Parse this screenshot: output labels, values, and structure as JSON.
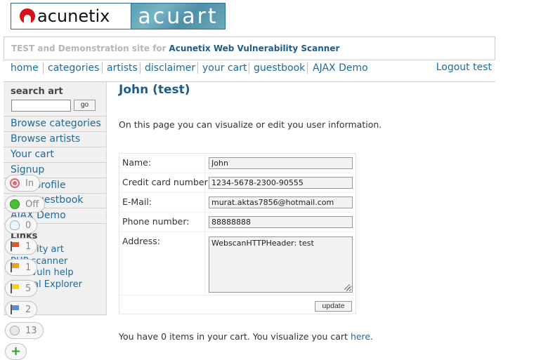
{
  "logo": {
    "left_text": "acunetix",
    "right_text": "acuart"
  },
  "tagline": {
    "prefix": "TEST and Demonstration site for",
    "product": "Acunetix Web Vulnerability Scanner"
  },
  "nav": {
    "items": [
      "home",
      "categories",
      "artists",
      "disclaimer",
      "your cart",
      "guestbook",
      "AJAX Demo"
    ],
    "logout": "Logout test"
  },
  "sidebar": {
    "search_title": "search art",
    "search_placeholder": "",
    "go": "go",
    "links": [
      "Browse categories",
      "Browse artists",
      "Your cart",
      "Signup",
      "Your profile",
      "Our guestbook",
      "AJAX Demo"
    ],
    "section_links": "Links",
    "extra_links": [
      "Security art",
      "PHP scanner",
      "PHP vuln help",
      "Fractal Explorer"
    ]
  },
  "main": {
    "title": "John (test)",
    "intro": "On this page you can visualize or edit you user information.",
    "form": {
      "name_label": "Name:",
      "name_value": "John",
      "cc_label": "Credit card number:",
      "cc_value": "1234-5678-2300-90555",
      "email_label": "E-Mail:",
      "email_value": "murat.aktas7856@hotmail.com",
      "phone_label": "Phone number:",
      "phone_value": "88888888",
      "address_label": "Address:",
      "address_value": "WebscanHTTPHeader: test",
      "update": "update"
    },
    "cart_note_prefix": "You have 0 items in your cart. You visualize you cart",
    "cart_note_link": "here",
    "cart_note_suffix": "."
  },
  "badges": [
    {
      "icon": "target-icon",
      "text": "In"
    },
    {
      "icon": "green-dot-icon",
      "text": "Off"
    },
    {
      "icon": "bulb-icon",
      "text": "0"
    },
    {
      "icon": "red-flag-icon",
      "text": "1",
      "color": "#e05a2a"
    },
    {
      "icon": "orange-flag-icon",
      "text": "1",
      "color": "#f0a020"
    },
    {
      "icon": "yellow-flag-icon",
      "text": "5",
      "color": "#f2d21a"
    },
    {
      "icon": "blue-flag-icon",
      "text": "2",
      "color": "#5a8fd0"
    },
    {
      "icon": "comment-icon",
      "text": "13"
    },
    {
      "icon": "plus-icon",
      "text": ""
    }
  ],
  "colors": {
    "link": "#1f6b9a",
    "title": "#1f5c8a",
    "sidebar_bg": "#f0f0f0"
  }
}
